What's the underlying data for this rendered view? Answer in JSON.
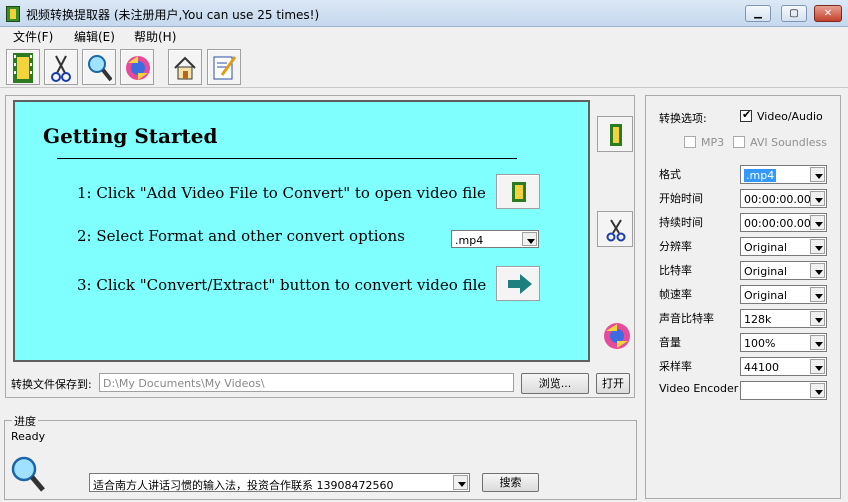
{
  "window": {
    "title": "视频转换提取器 (未注册用户,You can use 25 times!)"
  },
  "menu": [
    "文件(F)",
    "编辑(E)",
    "帮助(H)"
  ],
  "getting_started": {
    "title": "Getting Started",
    "step1": "1: Click \"Add Video File to Convert\" to open video file",
    "step2": "2: Select Format and other convert options",
    "step2_format": ".mp4",
    "step3": "3: Click \"Convert/Extract\" button to convert video file"
  },
  "save": {
    "label": "转换文件保存到:",
    "path": "D:\\My Documents\\My Videos\\",
    "browse": "浏览...",
    "open": "打开"
  },
  "options": {
    "convert_label": "转换选项:",
    "video_audio": "Video/Audio",
    "mp3": "MP3",
    "avi_soundless": "AVI Soundless",
    "rows": [
      {
        "label": "格式",
        "value": ".mp4"
      },
      {
        "label": "开始时间",
        "value": "00:00:00.00"
      },
      {
        "label": "持续时间",
        "value": "00:00:00.00"
      },
      {
        "label": "分辨率",
        "value": "Original"
      },
      {
        "label": "比特率",
        "value": "Original"
      },
      {
        "label": "帧速率",
        "value": "Original"
      },
      {
        "label": "声音比特率",
        "value": "128k"
      },
      {
        "label": "音量",
        "value": "100%"
      },
      {
        "label": "采样率",
        "value": "44100"
      },
      {
        "label": "Video Encoder",
        "value": ""
      }
    ]
  },
  "progress": {
    "legend": "进度",
    "status": "Ready",
    "ad_text": "适合南方人讲话习惯的输入法，投资合作联系 13908472560",
    "search": "搜索"
  }
}
